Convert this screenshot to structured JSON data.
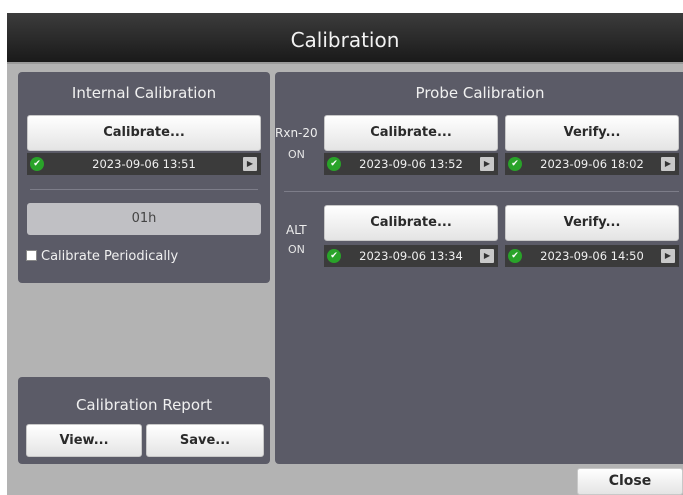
{
  "window": {
    "title": "Calibration"
  },
  "internal": {
    "title": "Internal Calibration",
    "calibrate_label": "Calibrate...",
    "timestamp": "2023-09-06 13:51",
    "interval_value": "01h",
    "periodic_label": "Calibrate Periodically",
    "periodic_checked": false
  },
  "report": {
    "title": "Calibration Report",
    "view_label": "View...",
    "save_label": "Save..."
  },
  "probe": {
    "title": "Probe Calibration",
    "probes": [
      {
        "name": "Rxn-20",
        "state": "ON",
        "calibrate_label": "Calibrate...",
        "calibrate_timestamp": "2023-09-06 13:52",
        "verify_label": "Verify...",
        "verify_timestamp": "2023-09-06 18:02"
      },
      {
        "name": "ALT",
        "state": "ON",
        "calibrate_label": "Calibrate...",
        "calibrate_timestamp": "2023-09-06 13:34",
        "verify_label": "Verify...",
        "verify_timestamp": "2023-09-06 14:50"
      }
    ]
  },
  "footer": {
    "close_label": "Close"
  },
  "icons": {
    "status_ok": "check-circle-icon",
    "details": "chevron-right-icon"
  },
  "colors": {
    "panel": "#5b5b67",
    "ok": "#29a329",
    "background": "#b3b3b3"
  }
}
